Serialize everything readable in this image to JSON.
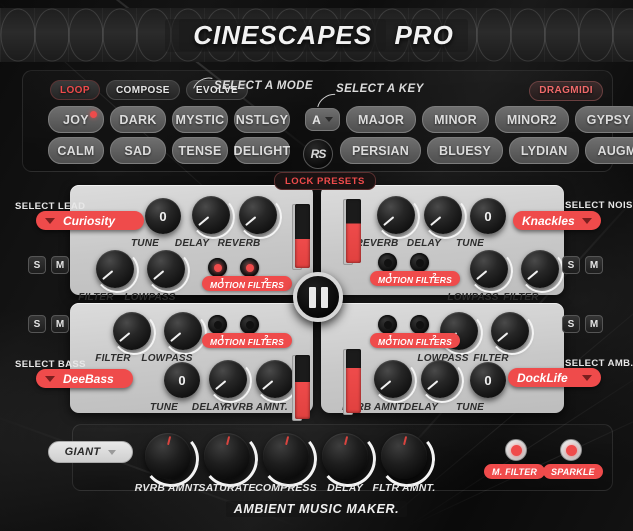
{
  "app": {
    "title_main": "CINESCAPES",
    "title_accent": "PRO",
    "footer": "AMBIENT MUSIC MAKER.",
    "logo_mark": "RS",
    "accent_color": "#ef4b4b",
    "panel_color": "#d2d2d2"
  },
  "topbar": {
    "modes": [
      {
        "label": "LOOP",
        "active": true
      },
      {
        "label": "COMPOSE",
        "active": false
      },
      {
        "label": "EVOLVE",
        "active": false
      }
    ],
    "mode_hint": "SELECT A MODE",
    "key_hint": "SELECT A KEY",
    "dragmidi_label": "DRAGMIDI",
    "lock_presets_label": "LOCK PRESETS",
    "moods_row1": [
      {
        "label": "JOY",
        "selected": true
      },
      {
        "label": "DARK",
        "selected": false
      },
      {
        "label": "MYSTIC",
        "selected": false
      },
      {
        "label": "NSTLGY",
        "selected": false
      }
    ],
    "moods_row2": [
      {
        "label": "CALM",
        "selected": false
      },
      {
        "label": "SAD",
        "selected": false
      },
      {
        "label": "TENSE",
        "selected": false
      },
      {
        "label": "DELIGHT",
        "selected": false
      }
    ],
    "key_value": "A",
    "scales_row1": [
      "MAJOR",
      "MINOR",
      "MINOR2",
      "GYPSY"
    ],
    "scales_row2": [
      "PERSIAN",
      "BLUESY",
      "LYDIAN",
      "AUGMN."
    ]
  },
  "transport": {
    "state": "pause"
  },
  "tracks": [
    {
      "id": "lead",
      "select_label": "SELECT LEAD",
      "preset": "Curiosity",
      "solo": "S",
      "mute": "M",
      "knobs": [
        {
          "name": "TUNE",
          "value": "0"
        },
        {
          "name": "DELAY",
          "value": ""
        },
        {
          "name": "REVERB",
          "value": ""
        },
        {
          "name": "FILTER",
          "value": ""
        },
        {
          "name": "LOWPASS",
          "value": ""
        }
      ],
      "motion_filters_label": "MOTION FILTERS",
      "motion_filter_1": {
        "label": "1",
        "on": true
      },
      "motion_filter_2": {
        "label": "2",
        "on": true
      },
      "volume": 45
    },
    {
      "id": "noise",
      "select_label": "SELECT NOISE",
      "preset": "Knackles",
      "solo": "S",
      "mute": "M",
      "knobs": [
        {
          "name": "REVERB",
          "value": ""
        },
        {
          "name": "DELAY",
          "value": ""
        },
        {
          "name": "TUNE",
          "value": "0"
        },
        {
          "name": "LOWPASS",
          "value": ""
        },
        {
          "name": "FILTER",
          "value": ""
        }
      ],
      "motion_filters_label": "MOTION FILTERS",
      "motion_filter_1": {
        "label": "1",
        "on": false
      },
      "motion_filter_2": {
        "label": "2",
        "on": false
      },
      "volume": 62
    },
    {
      "id": "bass",
      "select_label": "SELECT BASS",
      "preset": "DeeBass",
      "solo": "S",
      "mute": "M",
      "knobs": [
        {
          "name": "FILTER",
          "value": ""
        },
        {
          "name": "LOWPASS",
          "value": ""
        },
        {
          "name": "TUNE",
          "value": "0"
        },
        {
          "name": "DELAY",
          "value": ""
        },
        {
          "name": "RVRB AMNT.",
          "value": ""
        }
      ],
      "motion_filters_label": "MOTION FILTERS",
      "motion_filter_1": {
        "label": "1",
        "on": false
      },
      "motion_filter_2": {
        "label": "2",
        "on": false
      },
      "volume": 58
    },
    {
      "id": "amb",
      "select_label": "SELECT AMB.",
      "preset": "DockLife",
      "solo": "S",
      "mute": "M",
      "knobs": [
        {
          "name": "LOWPASS",
          "value": ""
        },
        {
          "name": "FILTER",
          "value": ""
        },
        {
          "name": "RVRB AMNT.",
          "value": ""
        },
        {
          "name": "DELAY",
          "value": ""
        },
        {
          "name": "TUNE",
          "value": "0"
        }
      ],
      "motion_filters_label": "MOTION FILTERS",
      "motion_filter_1": {
        "label": "1",
        "on": false
      },
      "motion_filter_2": {
        "label": "2",
        "on": false
      },
      "volume": 70
    }
  ],
  "master": {
    "preset": "GIANT",
    "knobs": [
      {
        "name": "RVRB AMNT."
      },
      {
        "name": "SATURATE"
      },
      {
        "name": "COMPRESS"
      },
      {
        "name": "DELAY"
      },
      {
        "name": "FLTR AMNT."
      }
    ],
    "toggles": [
      {
        "label": "M. FILTER",
        "on": true
      },
      {
        "label": "SPARKLE",
        "on": true
      }
    ]
  }
}
